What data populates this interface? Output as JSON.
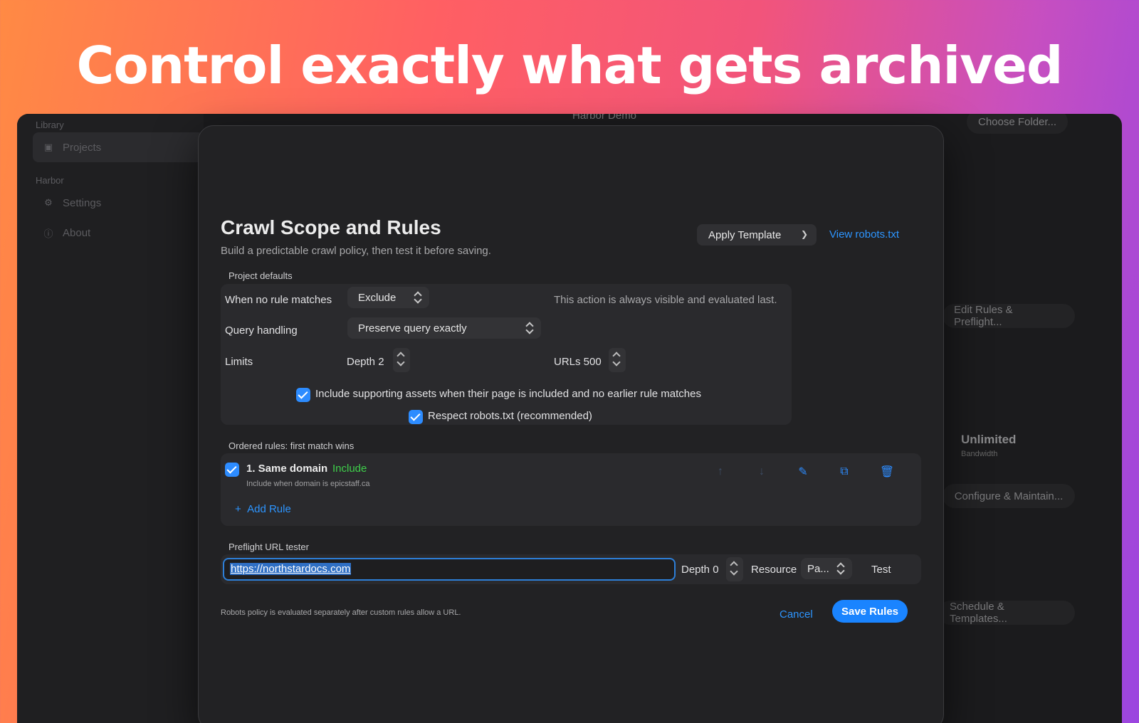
{
  "headline": "Control exactly what gets archived",
  "sidebar": {
    "library_section": "Library",
    "harbor_section": "Harbor",
    "items": [
      {
        "label": "Projects",
        "icon": "box-icon"
      },
      {
        "label": "Settings",
        "icon": "gear-icon"
      },
      {
        "label": "About",
        "icon": "info-icon"
      }
    ]
  },
  "background": {
    "project_name": "Harbor Demo",
    "choose_folder": "Choose Folder...",
    "edit_rules": "Edit Rules & Preflight...",
    "unlimited": "Unlimited",
    "bandwidth": "Bandwidth",
    "configure": "Configure & Maintain...",
    "schedule": "Schedule & Templates..."
  },
  "modal": {
    "title": "Crawl Scope and Rules",
    "subtitle": "Build a predictable crawl policy, then test it before saving.",
    "apply_template": "Apply Template",
    "view_robots": "View robots.txt",
    "defaults": {
      "section_label": "Project defaults",
      "no_match_label": "When no rule matches",
      "no_match_value": "Exclude",
      "no_match_note": "This action is always visible and evaluated last.",
      "query_label": "Query handling",
      "query_value": "Preserve query exactly",
      "limits_label": "Limits",
      "depth_label": "Depth 2",
      "urls_label": "URLs 500",
      "include_assets": "Include supporting assets when their page is included and no earlier rule matches",
      "include_assets_checked": true,
      "respect_robots": "Respect robots.txt (recommended)",
      "respect_robots_checked": true
    },
    "rules": {
      "section_label": "Ordered rules: first match wins",
      "items": [
        {
          "title": "1. Same domain",
          "action": "Include",
          "description": "Include when domain is epicstaff.ca",
          "enabled": true
        }
      ],
      "add_rule": "Add Rule"
    },
    "preflight": {
      "section_label": "Preflight URL tester",
      "url_value": "https://northstardocs.com",
      "depth_label": "Depth 0",
      "resource_label": "Resource",
      "resource_value": "Pa...",
      "test": "Test"
    },
    "footer_note": "Robots policy is evaluated separately after custom rules allow a URL.",
    "cancel": "Cancel",
    "save": "Save Rules"
  },
  "colors": {
    "accent": "#1a84ff",
    "include_green": "#3ecf4a",
    "modal_bg": "#222224"
  }
}
